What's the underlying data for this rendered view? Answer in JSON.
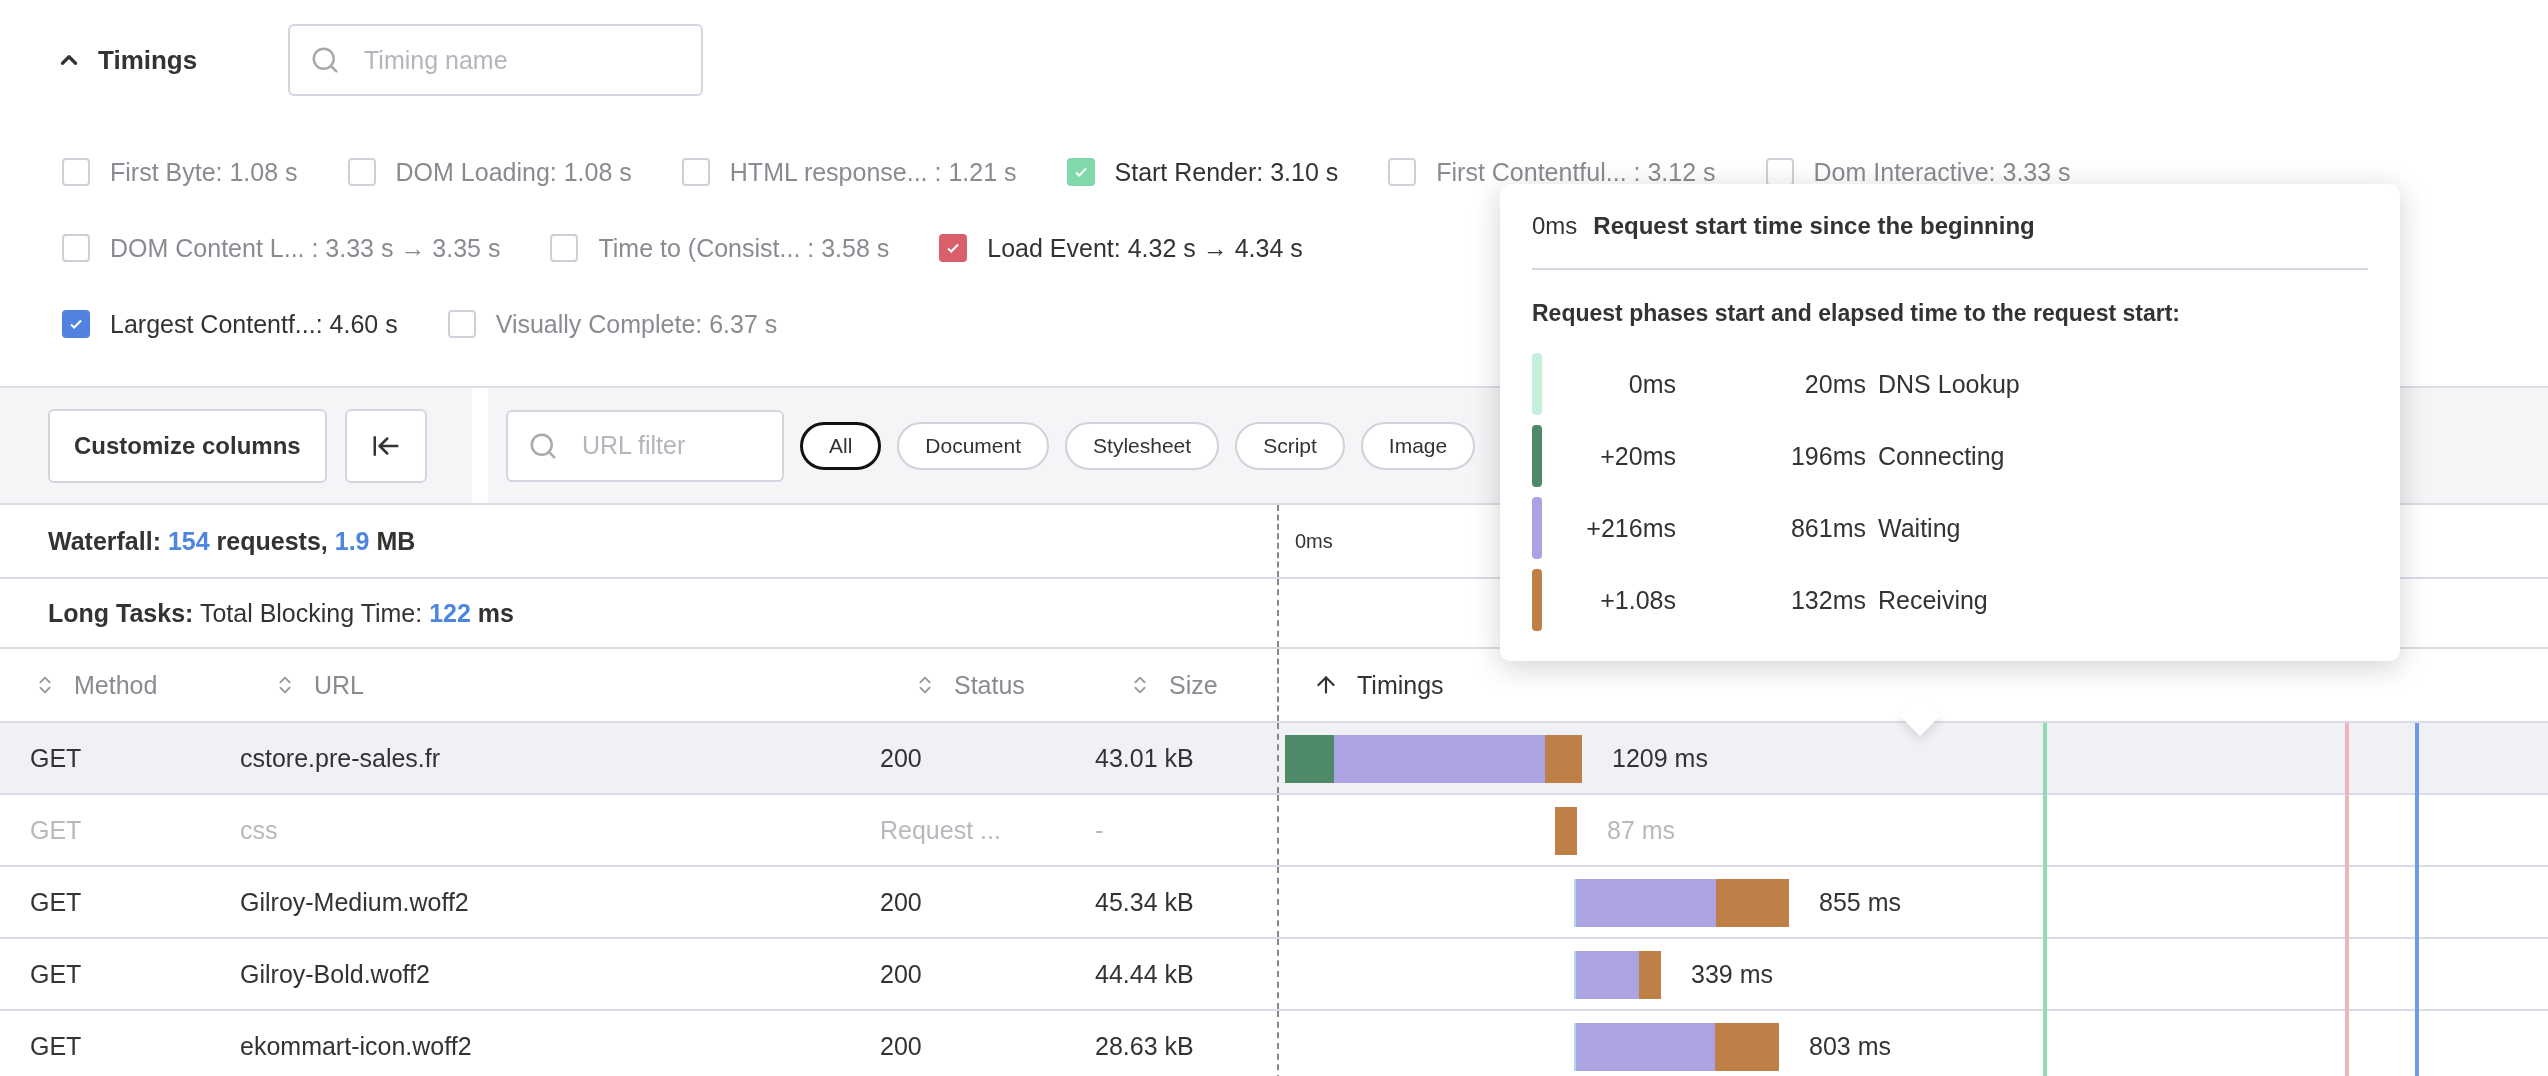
{
  "timings": {
    "title": "Timings",
    "expanded": true,
    "search": {
      "placeholder": "Timing name"
    },
    "rows": [
      {
        "items": [
          {
            "label": "First Byte: 1.08 s",
            "checked": false
          },
          {
            "label": "DOM Loading: 1.08 s",
            "checked": false
          },
          {
            "label": "HTML response... : 1.21 s",
            "checked": false
          },
          {
            "label": "Start Render: 3.10 s",
            "checked": true,
            "color": "#7fd9a8"
          },
          {
            "label": "First Contentful... : 3.12 s",
            "checked": false
          },
          {
            "label": "Dom Interactive: 3.33 s",
            "checked": false
          }
        ]
      },
      {
        "items": [
          {
            "label": "DOM Content L... : 3.33 s → 3.35 s",
            "checked": false
          },
          {
            "label": "Time to (Consist... : 3.58 s",
            "checked": false
          },
          {
            "label": "Load Event: 4.32 s → 4.34 s",
            "checked": true,
            "color": "#d9606a"
          }
        ]
      },
      {
        "items": [
          {
            "label": "Largest Contentf...: 4.60 s",
            "checked": true,
            "color": "#5282e0"
          },
          {
            "label": "Visually Complete: 6.37 s",
            "checked": false
          }
        ]
      }
    ]
  },
  "toolbar": {
    "customize_button": "Customize columns",
    "url_filter": {
      "placeholder": "URL filter"
    },
    "filters": [
      {
        "label": "All",
        "selected": true
      },
      {
        "label": "Document",
        "selected": false
      },
      {
        "label": "Stylesheet",
        "selected": false
      },
      {
        "label": "Script",
        "selected": false
      },
      {
        "label": "Image",
        "selected": false
      }
    ]
  },
  "summary": {
    "waterfall": {
      "label": "Waterfall:",
      "requests": "154",
      "requests_unit": "requests,",
      "size": "1.9",
      "size_unit": "MB"
    },
    "long_tasks": {
      "label": "Long Tasks:",
      "text": "Total Blocking Time:",
      "value": "122",
      "unit": "ms"
    },
    "axis_label": "0ms"
  },
  "table": {
    "columns": [
      {
        "label": "Method",
        "sorted": false
      },
      {
        "label": "URL",
        "sorted": false
      },
      {
        "label": "Status",
        "sorted": false
      },
      {
        "label": "Size",
        "sorted": false
      },
      {
        "label": "Timings",
        "sorted": true
      }
    ],
    "rows": [
      {
        "method": "GET",
        "url": "cstore.pre-sales.fr",
        "status": "200",
        "size": "43.01 kB",
        "duration": "1209 ms",
        "selected": true,
        "dimmed": false
      },
      {
        "method": "GET",
        "url": "css",
        "status": "Request ...",
        "size": "-",
        "duration": "87 ms",
        "selected": false,
        "dimmed": true
      },
      {
        "method": "GET",
        "url": "Gilroy-Medium.woff2",
        "status": "200",
        "size": "45.34 kB",
        "duration": "855 ms",
        "selected": false,
        "dimmed": false
      },
      {
        "method": "GET",
        "url": "Gilroy-Bold.woff2",
        "status": "200",
        "size": "44.44 kB",
        "duration": "339 ms",
        "selected": false,
        "dimmed": false
      },
      {
        "method": "GET",
        "url": "ekommart-icon.woff2",
        "status": "200",
        "size": "28.63 kB",
        "duration": "803 ms",
        "selected": false,
        "dimmed": false
      }
    ]
  },
  "markers": [
    {
      "color": "#8fdcb0"
    },
    {
      "color": "#f0b4bc"
    },
    {
      "color": "#6f9ae6"
    }
  ],
  "tooltip": {
    "start": "0ms",
    "start_label": "Request start time since the beginning",
    "heading": "Request phases start and elapsed time to the request start:",
    "phases": [
      {
        "color": "#c6f0dc",
        "start": "0ms",
        "duration": "20ms",
        "name": "DNS Lookup"
      },
      {
        "color": "#4e8a68",
        "start": "+20ms",
        "duration": "196ms",
        "name": "Connecting"
      },
      {
        "color": "#aba3e2",
        "start": "+216ms",
        "duration": "861ms",
        "name": "Waiting"
      },
      {
        "color": "#bf8048",
        "start": "+1.08s",
        "duration": "132ms",
        "name": "Receiving"
      }
    ]
  }
}
